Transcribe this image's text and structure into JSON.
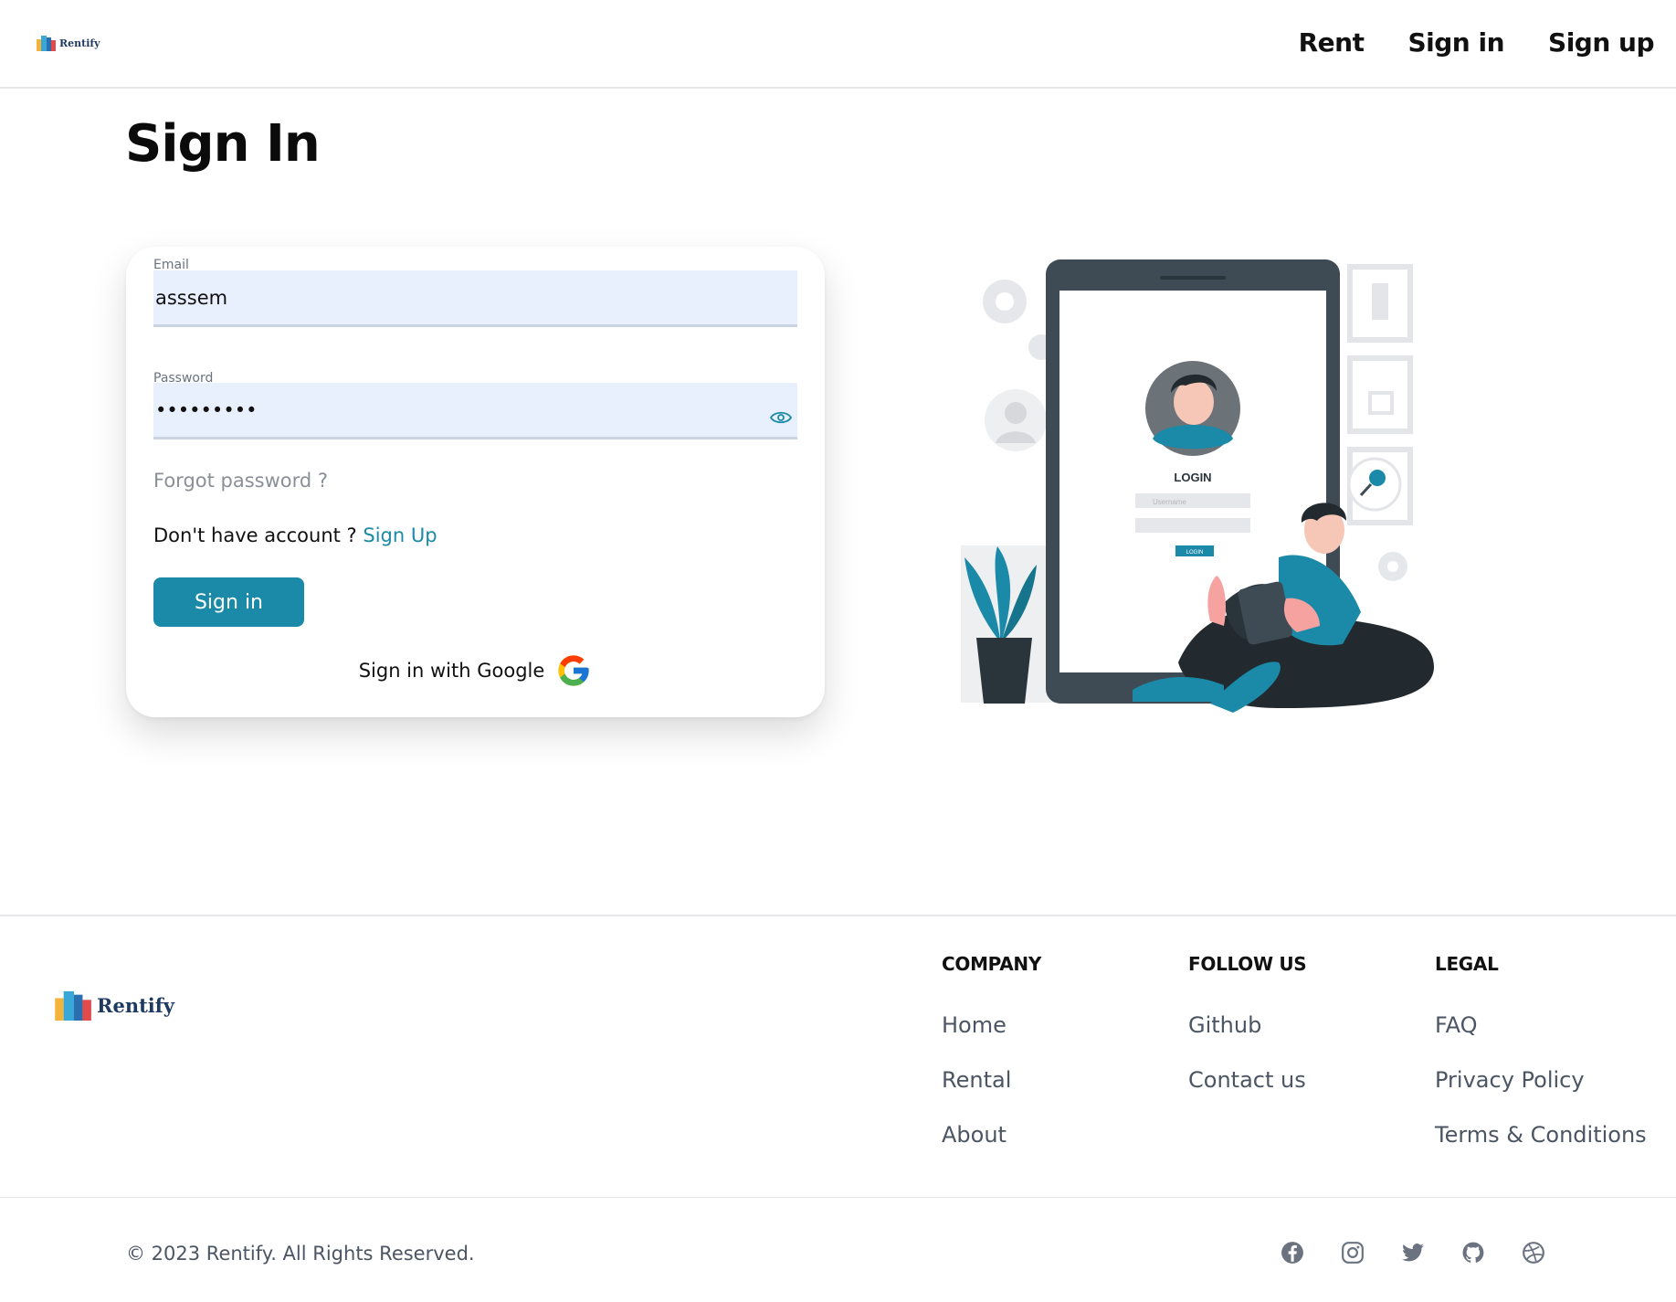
{
  "header": {
    "logo_text": "Rentify",
    "nav": [
      {
        "label": "Rent"
      },
      {
        "label": "Sign in"
      },
      {
        "label": "Sign up"
      }
    ]
  },
  "page": {
    "title": "Sign In"
  },
  "form": {
    "email": {
      "label": "Email",
      "value": "asssem"
    },
    "password": {
      "label": "Password",
      "value": "•••••••••"
    },
    "forgot_label": "Forgot password ?",
    "no_account_text": "Don't have account ?",
    "signup_link": "Sign Up",
    "submit_label": "Sign in",
    "google_label": "Sign in with Google"
  },
  "illustration": {
    "login_title": "LOGIN",
    "username_placeholder": "Username",
    "button_label": "LOGIN"
  },
  "footer": {
    "logo_text": "Rentify",
    "columns": [
      {
        "title": "COMPANY",
        "links": [
          "Home",
          "Rental",
          "About"
        ]
      },
      {
        "title": "FOLLOW US",
        "links": [
          "Github",
          "Contact us"
        ]
      },
      {
        "title": "LEGAL",
        "links": [
          "FAQ",
          "Privacy Policy",
          "Terms & Conditions"
        ]
      }
    ],
    "copyright": "© 2023 Rentify. All Rights Reserved.",
    "socials": [
      "facebook-icon",
      "instagram-icon",
      "twitter-icon",
      "github-icon",
      "dribbble-icon"
    ]
  },
  "colors": {
    "accent": "#1b8aa8",
    "input_bg": "#e8f0fe",
    "dark": "#3f4b54"
  }
}
